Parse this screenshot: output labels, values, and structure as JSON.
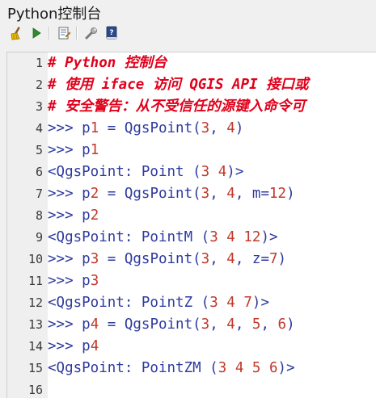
{
  "window": {
    "title": "Python控制台"
  },
  "toolbar": {
    "buttons": [
      {
        "name": "clear-console-button",
        "icon": "broom-icon"
      },
      {
        "name": "run-command-button",
        "icon": "play-icon"
      },
      {
        "name": "show-editor-button",
        "icon": "editor-icon"
      },
      {
        "name": "options-button",
        "icon": "wrench-icon"
      },
      {
        "name": "help-button",
        "icon": "help-book-icon"
      }
    ]
  },
  "console": {
    "lines": [
      {
        "n": "1",
        "kind": "comment",
        "text": "# Python 控制台"
      },
      {
        "n": "2",
        "kind": "comment",
        "text": "# 使用 iface 访问 QGIS API 接口或"
      },
      {
        "n": "3",
        "kind": "comment",
        "text": "# 安全警告：从不受信任的源键入命令可"
      },
      {
        "n": "4",
        "kind": "input",
        "prompt": ">>>",
        "text": " p1 = QgsPoint(3, 4)"
      },
      {
        "n": "5",
        "kind": "input",
        "prompt": ">>>",
        "text": " p1"
      },
      {
        "n": "6",
        "kind": "output",
        "text": "<QgsPoint: Point (3 4)>"
      },
      {
        "n": "7",
        "kind": "input",
        "prompt": ">>>",
        "text": " p2 = QgsPoint(3, 4, m=12)"
      },
      {
        "n": "8",
        "kind": "input",
        "prompt": ">>>",
        "text": " p2"
      },
      {
        "n": "9",
        "kind": "output",
        "text": "<QgsPoint: PointM (3 4 12)>"
      },
      {
        "n": "10",
        "kind": "input",
        "prompt": ">>>",
        "text": " p3 = QgsPoint(3, 4, z=7)"
      },
      {
        "n": "11",
        "kind": "input",
        "prompt": ">>>",
        "text": " p3"
      },
      {
        "n": "12",
        "kind": "output",
        "text": "<QgsPoint: PointZ (3 4 7)>"
      },
      {
        "n": "13",
        "kind": "input",
        "prompt": ">>>",
        "text": " p4 = QgsPoint(3, 4, 5, 6)"
      },
      {
        "n": "14",
        "kind": "input",
        "prompt": ">>>",
        "text": " p4"
      },
      {
        "n": "15",
        "kind": "output",
        "text": "<QgsPoint: PointZM (3 4 5 6)>"
      },
      {
        "n": "16",
        "kind": "empty",
        "text": ""
      }
    ]
  },
  "colors": {
    "comment": "#e1001b",
    "code": "#2e3a9f",
    "number": "#c0392b",
    "gutter_bg": "#efefef"
  }
}
